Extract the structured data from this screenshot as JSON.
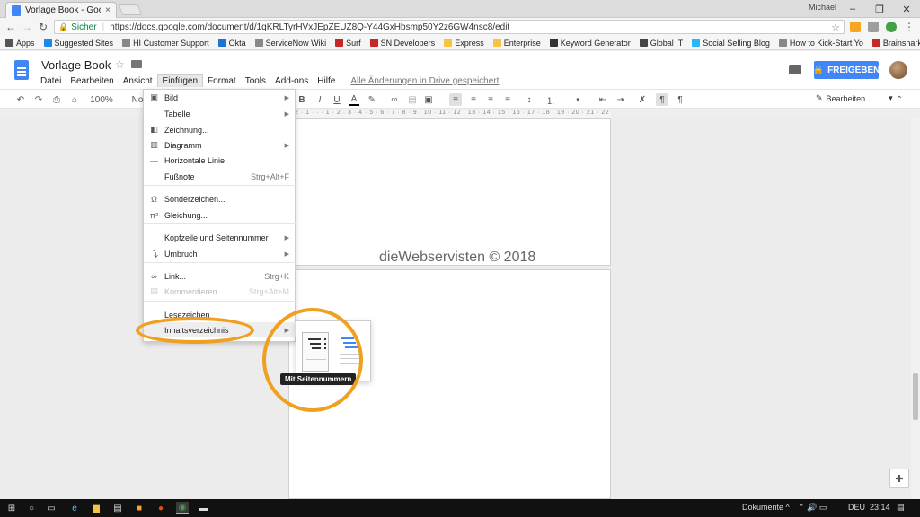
{
  "browser": {
    "tab_title": "Vorlage Book - Google D",
    "tab_close": "×",
    "user_label": "Michael",
    "minimize": "–",
    "maximize": "❐",
    "close": "✕",
    "secure_label": "Sicher",
    "url": "https://docs.google.com/document/d/1qKRLTyrHVxJEpZEUZ8Q-Y44GxHbsmp50Y2z6GW4nsc8/edit"
  },
  "bookmarks": [
    {
      "label": "Apps",
      "color": "#555555"
    },
    {
      "label": "Suggested Sites",
      "color": "#1e88e5"
    },
    {
      "label": "HI Customer Support",
      "color": "#888888"
    },
    {
      "label": "Okta",
      "color": "#1976d2"
    },
    {
      "label": "ServiceNow Wiki",
      "color": "#888888"
    },
    {
      "label": "Surf",
      "color": "#c62828"
    },
    {
      "label": "SN Developers",
      "color": "#c62828"
    },
    {
      "label": "Express",
      "color": "#f6c342"
    },
    {
      "label": "Enterprise",
      "color": "#f6c342"
    },
    {
      "label": "Keyword Generator",
      "color": "#333333"
    },
    {
      "label": "Global IT",
      "color": "#444444"
    },
    {
      "label": "Social Selling Blog",
      "color": "#29b6f6"
    },
    {
      "label": "How to Kick-Start Yo",
      "color": "#888888"
    },
    {
      "label": "Brainshark Learning",
      "color": "#c62828"
    }
  ],
  "doc": {
    "title": "Vorlage Book",
    "save_status": "Alle Änderungen in Drive gespeichert",
    "share_label": "FREIGEBEN",
    "menus": [
      "Datei",
      "Bearbeiten",
      "Ansicht",
      "Einfügen",
      "Format",
      "Tools",
      "Add-ons",
      "Hilfe"
    ],
    "active_menu": "Einfügen"
  },
  "format_toolbar": {
    "zoom": "100%",
    "style": "No",
    "edit_mode": "Bearbeiten"
  },
  "ruler_text": "2 · 1 · · · 1 · 2 · 3 · 4 · 5 · 6 · 7 · 8 · 9 · 10 · 11 · 12 · 13 · 14 · 15 · 16 · 17 · 18 · 19 · 20 · 21 · 22 · 23 · 24 · 25 · 26 · 27 · 28 · 29 · 30 · 31 · 32 · 33 · 34 · 35 · 36 · 37 · 38 · 39 · 40 · 41 · 42",
  "watermark": "dieWebservisten © 2018",
  "insert_menu": [
    {
      "label": "Bild",
      "icon": "image-icon",
      "glyph": "▣",
      "submenu": true
    },
    {
      "label": "Tabelle",
      "icon": "",
      "glyph": "",
      "submenu": true
    },
    {
      "label": "Zeichnung...",
      "icon": "drawing-icon",
      "glyph": "◧",
      "submenu": false
    },
    {
      "label": "Diagramm",
      "icon": "chart-icon",
      "glyph": "▥",
      "submenu": true
    },
    {
      "label": "Horizontale Linie",
      "icon": "line-icon",
      "glyph": "—",
      "submenu": false
    },
    {
      "label": "Fußnote",
      "icon": "",
      "glyph": "",
      "shortcut": "Strg+Alt+F"
    },
    {
      "label": "Sonderzeichen...",
      "icon": "omega-icon",
      "glyph": "Ω",
      "submenu": false
    },
    {
      "label": "Gleichung...",
      "icon": "pi-icon",
      "glyph": "π²",
      "submenu": false
    },
    {
      "label": "Kopfzeile und Seitennummer",
      "icon": "",
      "glyph": "",
      "submenu": true
    },
    {
      "label": "Umbruch",
      "icon": "break-icon",
      "glyph": "⤵",
      "submenu": true
    },
    {
      "label": "Link...",
      "icon": "link-icon",
      "glyph": "∞",
      "shortcut": "Strg+K"
    },
    {
      "label": "Kommentieren",
      "icon": "comment-icon",
      "glyph": "▤",
      "shortcut": "Strg+Alt+M",
      "disabled": true
    },
    {
      "label": "Lesezeichen",
      "icon": "",
      "glyph": ""
    },
    {
      "label": "Inhaltsverzeichnis",
      "icon": "",
      "glyph": "",
      "submenu": true,
      "highlighted": true
    }
  ],
  "submenu_arrow": "▶",
  "toc_tooltip": "Mit Seitennummern",
  "taskbar": {
    "language": "DEU",
    "time": "23:14",
    "documents_label": "Dokumente",
    "documents_chevron": "^",
    "tray_icons": "⌃ 🔊 ▭",
    "notification": "▤"
  },
  "colors": {
    "accent": "#4285f4",
    "annotation": "#f0a020",
    "secure": "#0b8043"
  }
}
